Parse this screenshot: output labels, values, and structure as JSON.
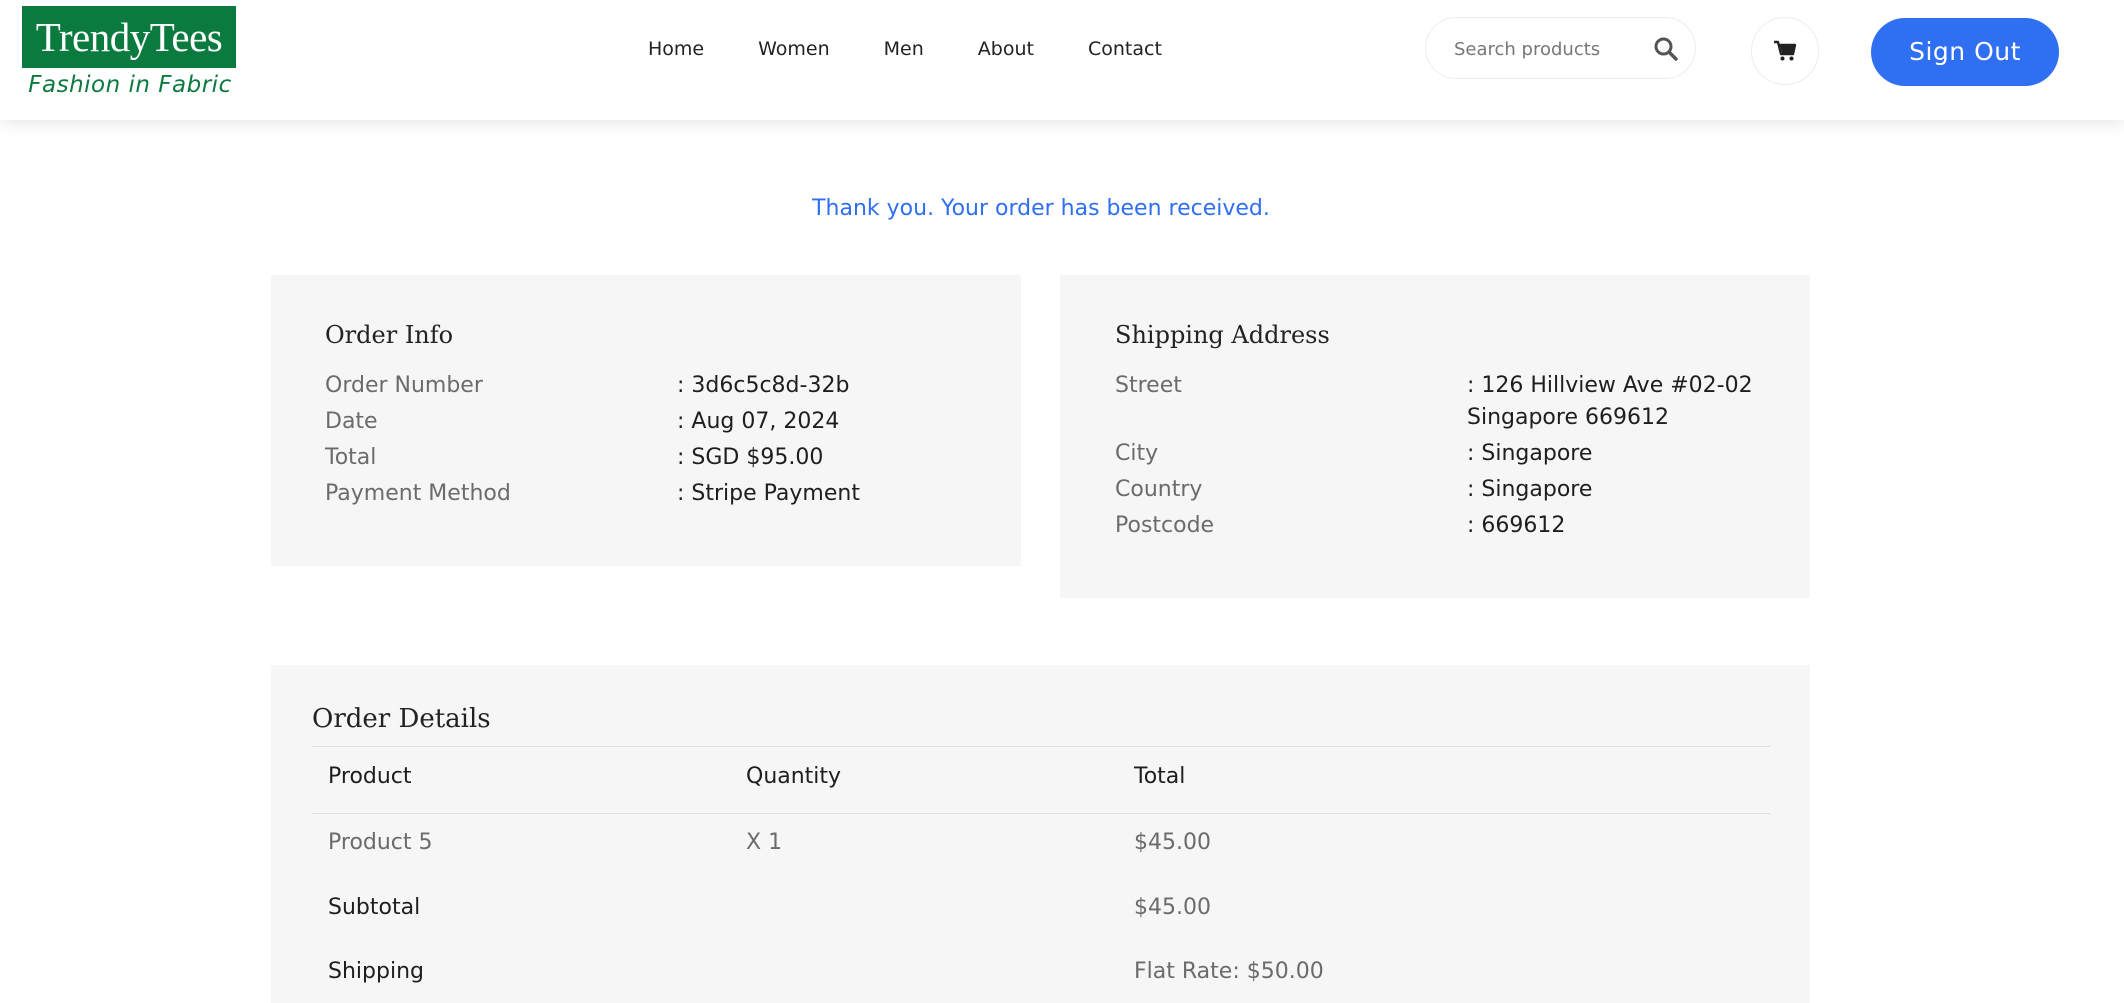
{
  "header": {
    "logo_title": "TrendyTees",
    "logo_tagline": "Fashion in Fabric",
    "nav": [
      "Home",
      "Women",
      "Men",
      "About",
      "Contact"
    ],
    "search_placeholder": "Search products",
    "signout_label": "Sign Out"
  },
  "thank_you": "Thank you. Your order has been received.",
  "order_info": {
    "title": "Order Info",
    "rows": [
      {
        "label": "Order Number",
        "value": ": 3d6c5c8d-32b"
      },
      {
        "label": "Date",
        "value": ": Aug 07, 2024"
      },
      {
        "label": "Total",
        "value": ": SGD $95.00"
      },
      {
        "label": "Payment Method",
        "value": ": Stripe Payment"
      }
    ]
  },
  "shipping_address": {
    "title": "Shipping Address",
    "rows": [
      {
        "label": "Street",
        "value": ": 126 Hillview Ave #02-02",
        "value_line2": "Singapore 669612"
      },
      {
        "label": "City",
        "value": ": Singapore"
      },
      {
        "label": "Country",
        "value": ": Singapore"
      },
      {
        "label": "Postcode",
        "value": ": 669612"
      }
    ]
  },
  "order_details": {
    "title": "Order Details",
    "columns": [
      "Product",
      "Quantity",
      "Total"
    ],
    "items": [
      {
        "product": "Product 5",
        "quantity": "X 1",
        "total": "$45.00"
      }
    ],
    "subtotal_label": "Subtotal",
    "subtotal_value": "$45.00",
    "shipping_label": "Shipping",
    "shipping_value": "Flat Rate: $50.00"
  },
  "colors": {
    "brand_green": "#0a7a3f",
    "accent_blue": "#2f6ff1",
    "card_bg": "#f6f6f6"
  }
}
